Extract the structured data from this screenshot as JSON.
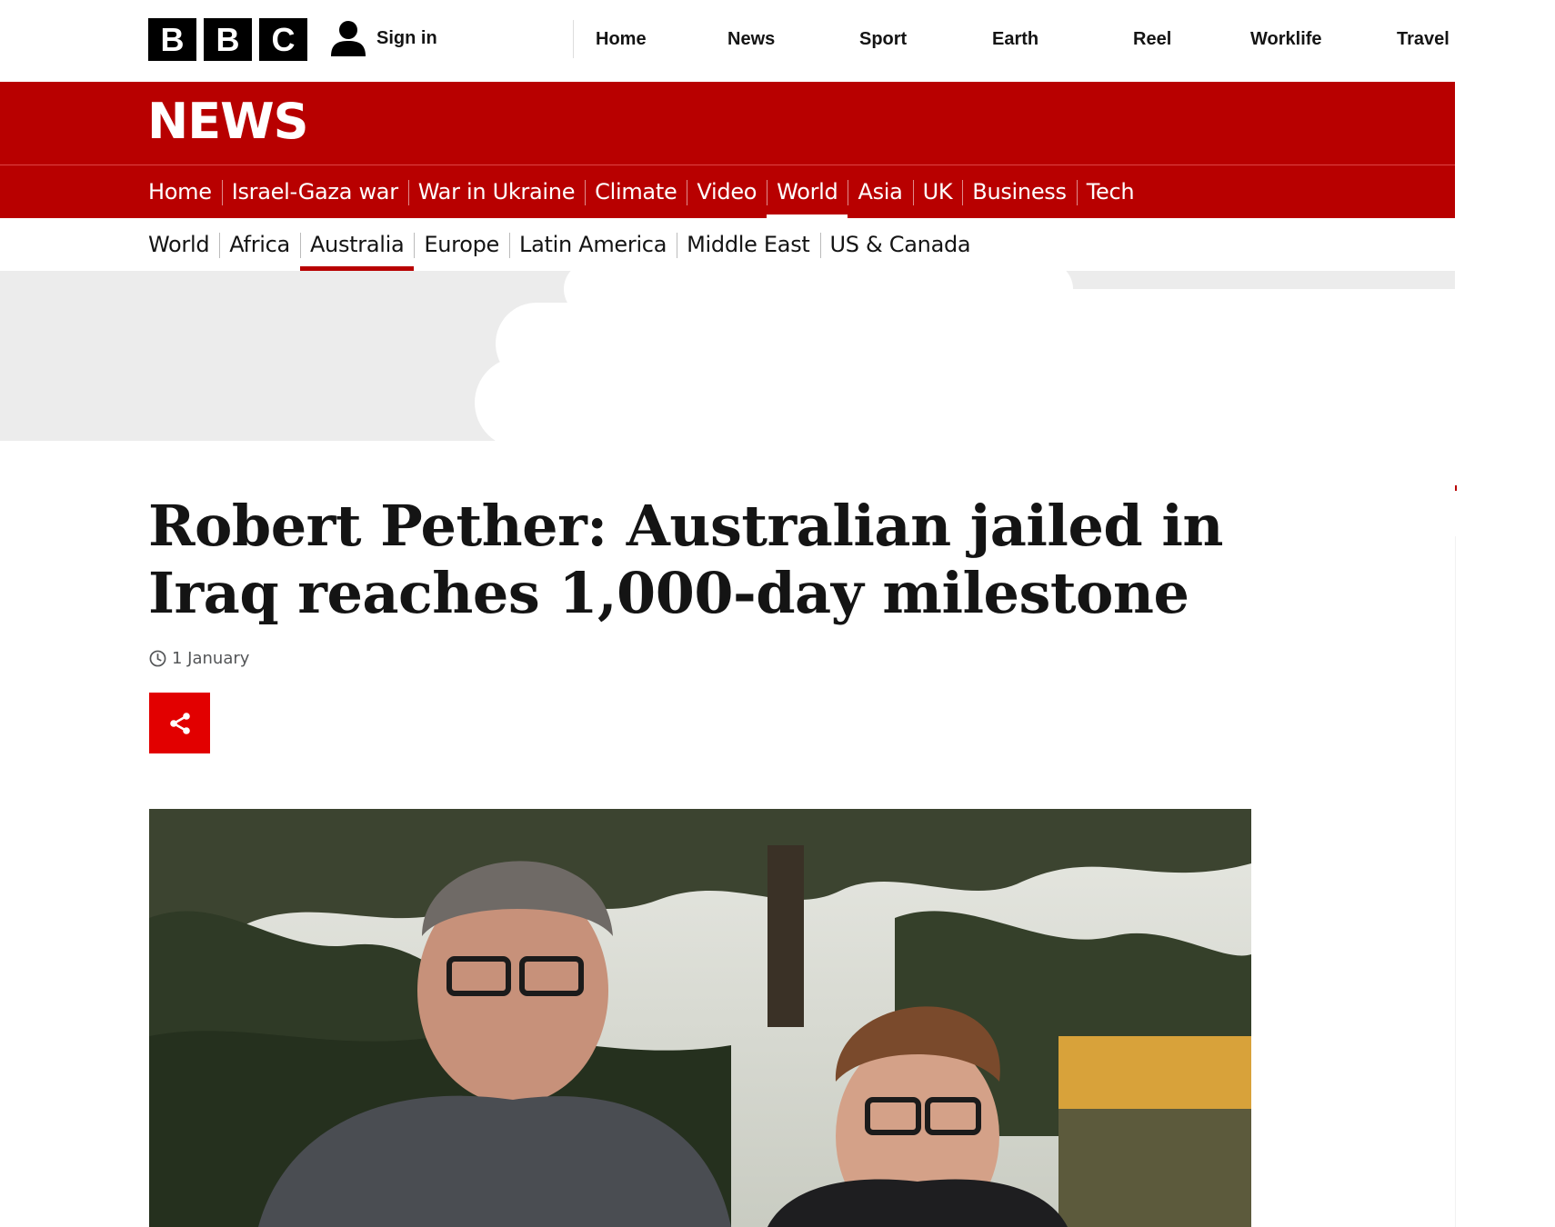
{
  "brand": {
    "logo_letters": [
      "B",
      "B",
      "C"
    ],
    "sign_in": "Sign in"
  },
  "global_nav": [
    "Home",
    "News",
    "Sport",
    "Earth",
    "Reel",
    "Worklife",
    "Travel"
  ],
  "news_band": {
    "title": "NEWS"
  },
  "section_nav": {
    "items": [
      "Home",
      "Israel-Gaza war",
      "War in Ukraine",
      "Climate",
      "Video",
      "World",
      "Asia",
      "UK",
      "Business",
      "Tech"
    ],
    "active": "World"
  },
  "sub_nav": {
    "items": [
      "World",
      "Africa",
      "Australia",
      "Europe",
      "Latin America",
      "Middle East",
      "US & Canada"
    ],
    "active": "Australia"
  },
  "article": {
    "headline": "Robert Pether: Australian jailed in Iraq reaches 1,000-day milestone",
    "date": "1 January",
    "share_icon": "share-icon",
    "clock_icon": "clock-icon"
  },
  "colors": {
    "bbc_red": "#b80000",
    "share_red": "#e20000",
    "ad_grey": "#ececec"
  }
}
